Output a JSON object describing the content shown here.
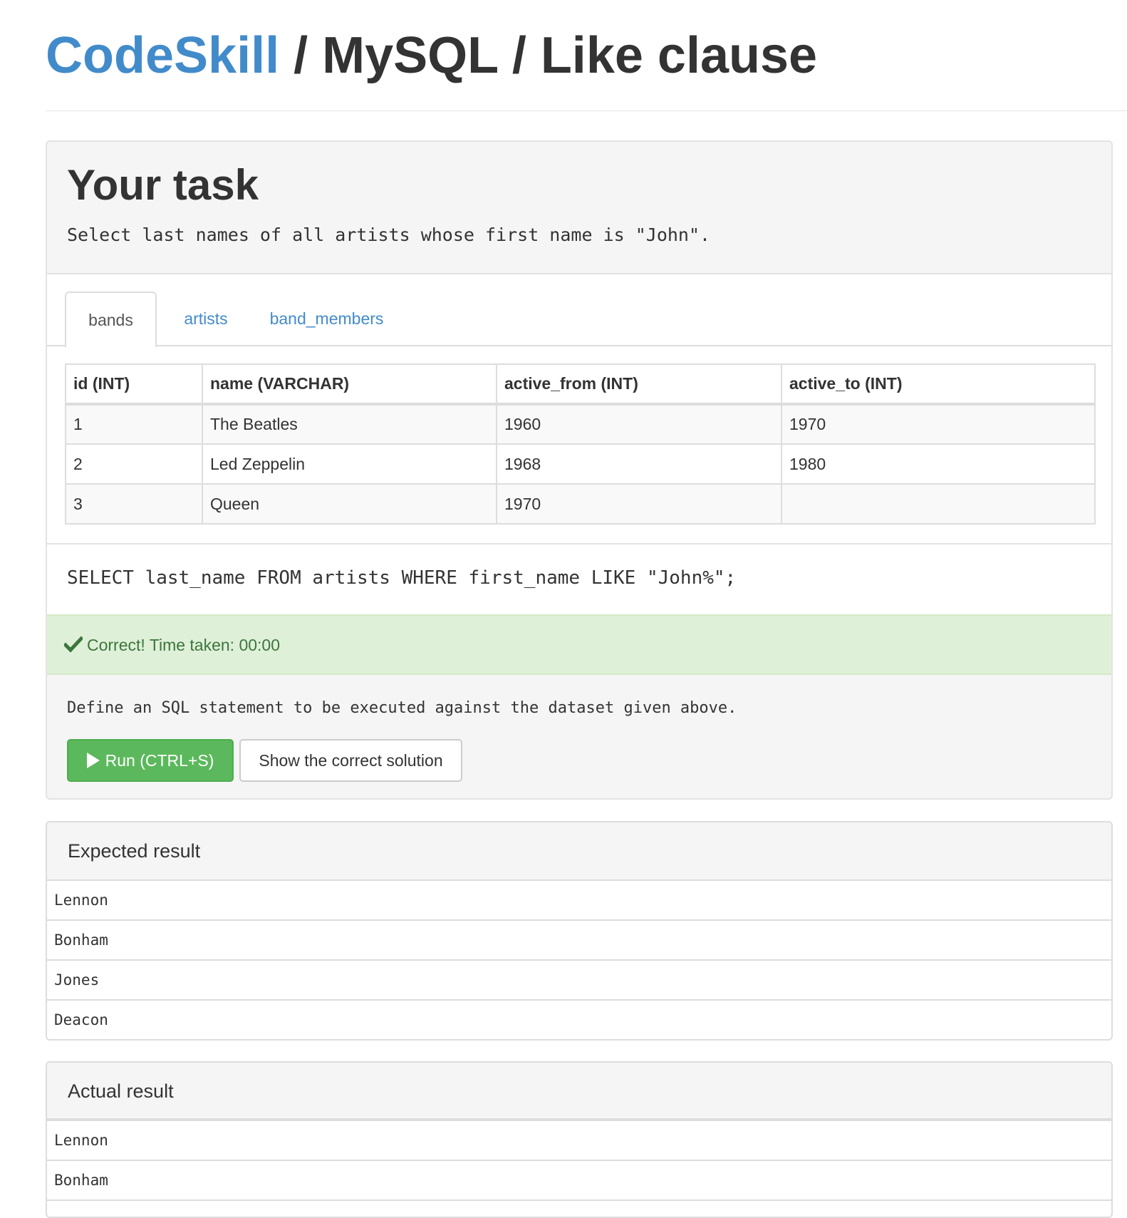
{
  "header": {
    "brand": "CodeSkill",
    "path": " / MySQL / Like clause"
  },
  "task": {
    "title": "Your task",
    "description": "Select last names of all artists whose first name is \"John\"."
  },
  "tabs": [
    {
      "label": "bands",
      "active": true
    },
    {
      "label": "artists",
      "active": false
    },
    {
      "label": "band_members",
      "active": false
    }
  ],
  "table": {
    "columns": [
      "id (INT)",
      "name (VARCHAR)",
      "active_from (INT)",
      "active_to (INT)"
    ],
    "rows": [
      [
        "1",
        "The Beatles",
        "1960",
        "1970"
      ],
      [
        "2",
        "Led Zeppelin",
        "1968",
        "1980"
      ],
      [
        "3",
        "Queen",
        "1970",
        ""
      ]
    ]
  },
  "query": "SELECT last_name FROM artists WHERE first_name LIKE \"John%\";",
  "status": {
    "icon": "check-icon",
    "message": "Correct! Time taken: 00:00",
    "color": "#3c763d",
    "background": "#dff0d8"
  },
  "instructions": "Define an SQL statement to be executed against the dataset given above.",
  "buttons": {
    "run": "Run (CTRL+S)",
    "run_icon": "play-icon",
    "solution": "Show the correct solution"
  },
  "expected": {
    "heading": "Expected result",
    "rows": [
      "Lennon",
      "Bonham",
      "Jones",
      "Deacon"
    ]
  },
  "actual": {
    "heading": "Actual result",
    "rows": [
      "Lennon",
      "Bonham"
    ]
  },
  "colors": {
    "brand": "#428bca",
    "success_button": "#5cb85c"
  }
}
